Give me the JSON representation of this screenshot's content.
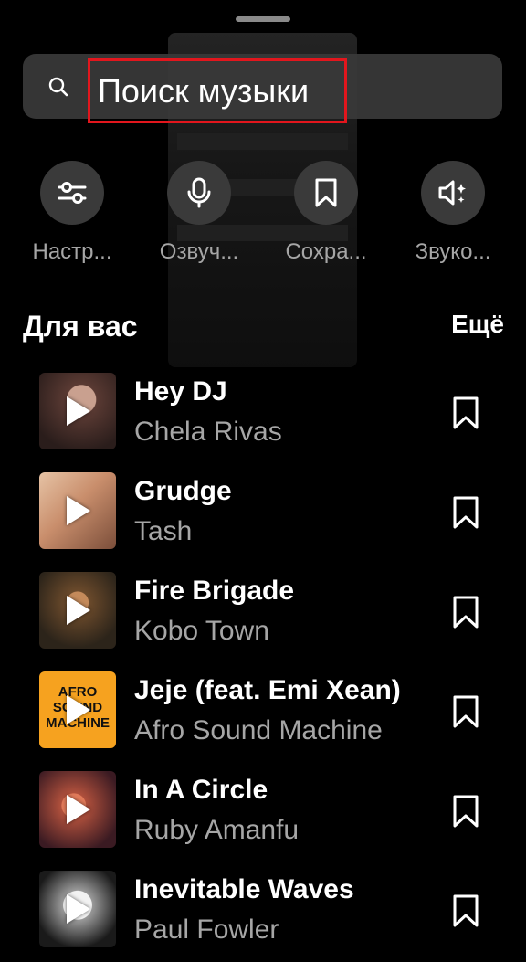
{
  "search": {
    "placeholder": "Поиск музыки",
    "highlight_color": "#e2161d"
  },
  "tools": [
    {
      "label": "Настр...",
      "icon": "sliders-icon"
    },
    {
      "label": "Озвуч...",
      "icon": "microphone-icon"
    },
    {
      "label": "Сохра...",
      "icon": "bookmark-icon"
    },
    {
      "label": "Звуко...",
      "icon": "sound-effects-icon"
    }
  ],
  "section": {
    "title": "Для вас",
    "more_label": "Ещё"
  },
  "tracks": [
    {
      "title": "Hey DJ",
      "artist": "Chela Rivas",
      "cover_color": "#7a5b52"
    },
    {
      "title": "Grudge",
      "artist": "Tash",
      "cover_color": "#c98e6c"
    },
    {
      "title": "Fire Brigade",
      "artist": "Kobo Town",
      "cover_color": "#6b4a2b"
    },
    {
      "title": "Jeje (feat. Emi Xean)",
      "artist": "Afro Sound Machine",
      "cover_color": "#f6a21f",
      "cover_text": "AFRO SOUND MACHINE"
    },
    {
      "title": "In A Circle",
      "artist": "Ruby Amanfu",
      "cover_color": "#b0503c"
    },
    {
      "title": "Inevitable Waves",
      "artist": "Paul Fowler",
      "cover_color": "#dcdcdc"
    }
  ],
  "colors": {
    "background": "#000000",
    "secondary_text": "#a6a6a6",
    "tool_circle": "#3a3a3a"
  }
}
